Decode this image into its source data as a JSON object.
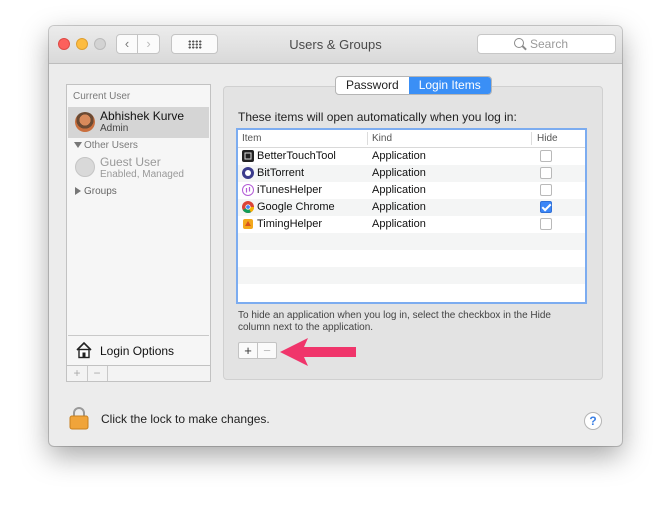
{
  "window": {
    "title": "Users & Groups"
  },
  "toolbar": {
    "back_icon": "chevron-left",
    "forward_icon": "chevron-right",
    "show_all_icon": "grid-dots"
  },
  "search": {
    "placeholder": "Search"
  },
  "sidebar": {
    "current_user_header": "Current User",
    "current_user": {
      "name": "Abhishek Kurve",
      "role": "Admin"
    },
    "other_users_header": "Other Users",
    "guest": {
      "name": "Guest User",
      "status": "Enabled, Managed"
    },
    "groups_label": "Groups",
    "login_options_label": "Login Options",
    "add_label": "+",
    "remove_label": "−"
  },
  "tabs": [
    {
      "label": "Password",
      "active": false
    },
    {
      "label": "Login Items",
      "active": true
    }
  ],
  "main": {
    "intro": "These items will open automatically when you log in:",
    "columns": {
      "item": "Item",
      "kind": "Kind",
      "hide": "Hide"
    },
    "items": [
      {
        "name": "BetterTouchTool",
        "kind": "Application",
        "hide": false,
        "icon": "bettertouchtool-icon"
      },
      {
        "name": "BitTorrent",
        "kind": "Application",
        "hide": false,
        "icon": "bittorrent-icon"
      },
      {
        "name": "iTunesHelper",
        "kind": "Application",
        "hide": false,
        "icon": "itunes-icon"
      },
      {
        "name": "Google Chrome",
        "kind": "Application",
        "hide": true,
        "icon": "chrome-icon"
      },
      {
        "name": "TimingHelper",
        "kind": "Application",
        "hide": false,
        "icon": "timing-icon"
      }
    ],
    "hint": "To hide an application when you log in, select the checkbox in the Hide column next to the application.",
    "add_label": "+",
    "remove_label": "−"
  },
  "footer": {
    "lock_label": "Click the lock to make changes.",
    "help_label": "?"
  },
  "colors": {
    "accent": "#3a8ff6",
    "annotation_arrow": "#f0356b"
  }
}
